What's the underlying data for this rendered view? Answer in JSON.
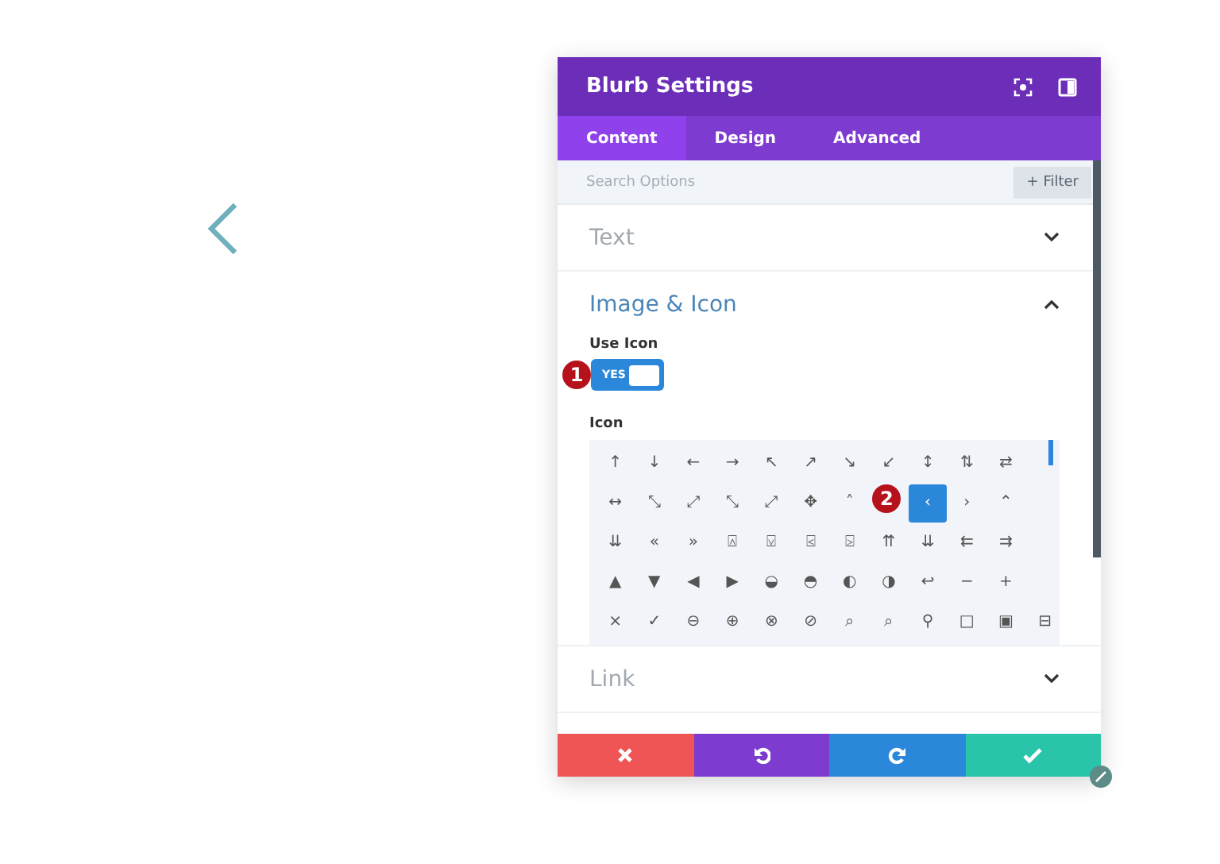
{
  "window": {
    "title": "Blurb Settings"
  },
  "tabs": [
    {
      "label": "Content",
      "selected": true
    },
    {
      "label": "Design",
      "selected": false
    },
    {
      "label": "Advanced",
      "selected": false
    }
  ],
  "search": {
    "placeholder": "Search Options"
  },
  "filter_button": {
    "icon": "+",
    "label": "Filter"
  },
  "sections": [
    {
      "title": "Text",
      "expanded": false
    },
    {
      "title": "Image & Icon",
      "expanded": true
    },
    {
      "title": "Link",
      "expanded": false
    }
  ],
  "use_icon": {
    "label": "Use Icon",
    "toggle_label": "YES",
    "on": true,
    "badge": "1"
  },
  "icon_picker": {
    "label": "Icon",
    "badge": "2",
    "rows": [
      [
        "↑",
        "↓",
        "←",
        "→",
        "↖",
        "↗",
        "↘",
        "↙",
        "↕",
        "⇅",
        "⇄"
      ],
      [
        "↔",
        "⤡",
        "⤢",
        "⤡",
        "⤢",
        "✥",
        "˄",
        null,
        {
          "glyph": "‹",
          "selected": true
        },
        "›",
        "⌃"
      ],
      [
        "⇊",
        "«",
        "»",
        "⍓",
        "⍌",
        "⍃",
        "⍄",
        "⇈",
        "⇊",
        "⇇",
        "⇉"
      ],
      [
        "▲",
        "▼",
        "◀",
        "▶",
        "◒",
        "◓",
        "◐",
        "◑",
        "↩",
        "−",
        "+"
      ],
      [
        "×",
        "✓",
        "⊖",
        "⊕",
        "⊗",
        "⊘",
        "⌕",
        "⌕",
        "⚲",
        "□",
        "▣",
        "⊟"
      ]
    ]
  }
}
